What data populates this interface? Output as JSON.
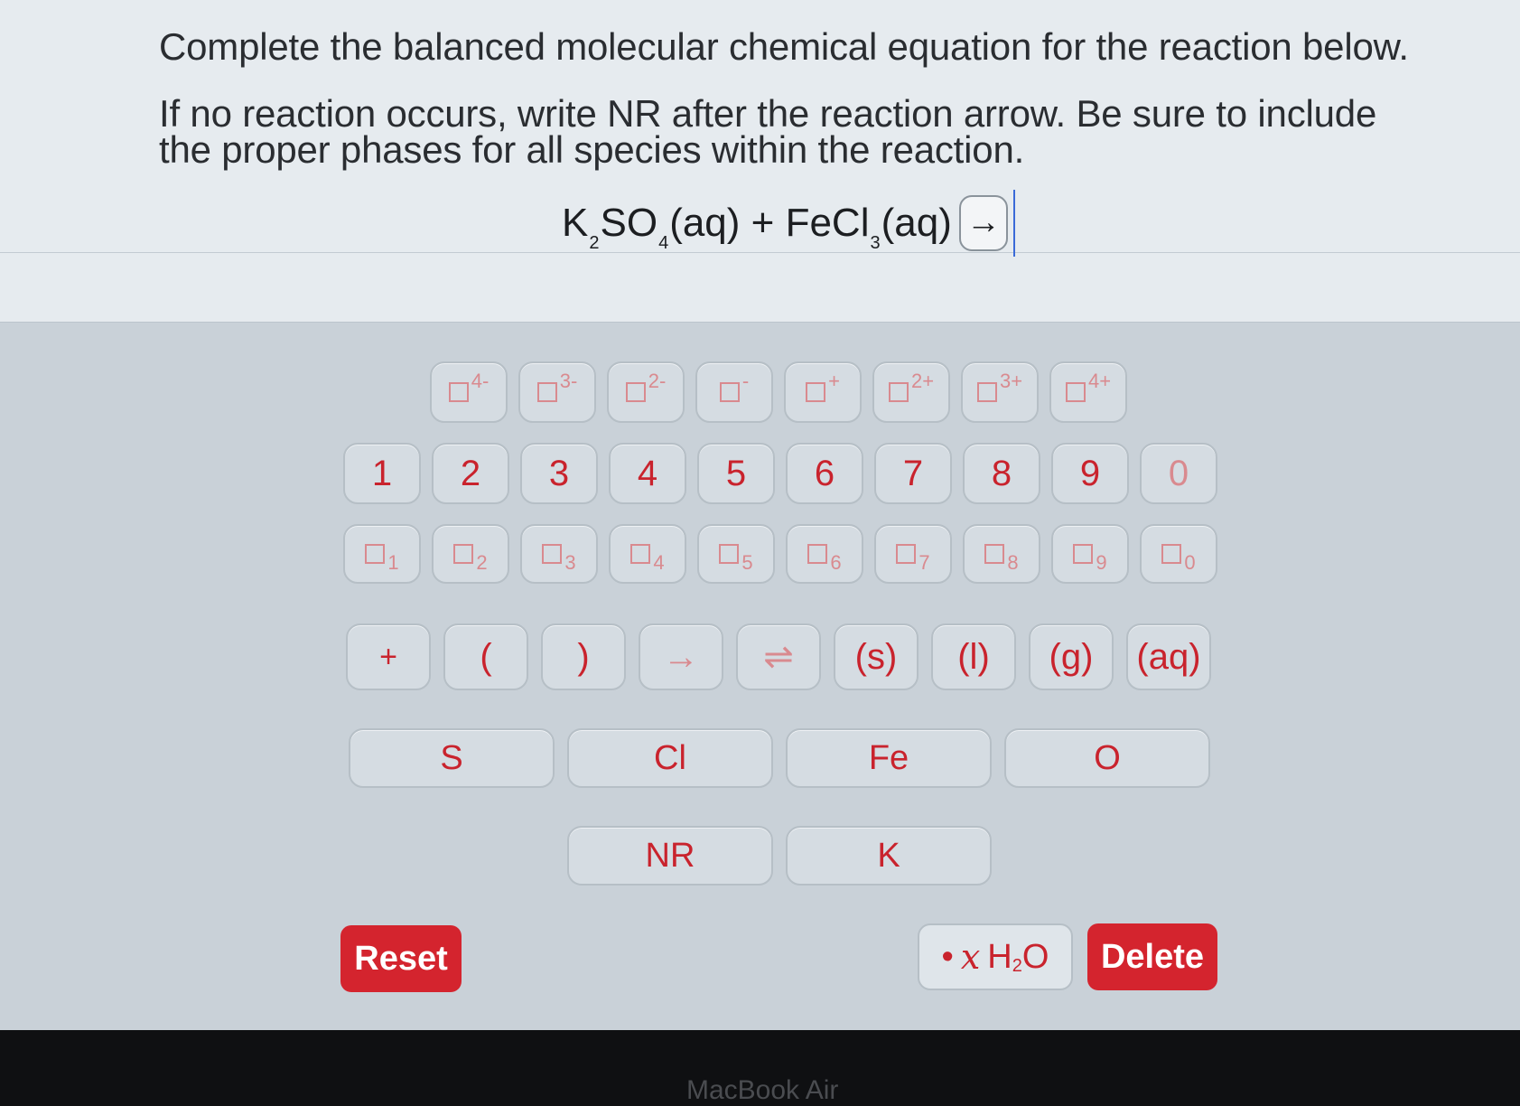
{
  "question": {
    "line1": "Complete the balanced molecular chemical equation for the reaction below.",
    "line2": "If no reaction occurs, write NR after the reaction arrow. Be sure to include",
    "line3": "the proper phases for all species within the reaction."
  },
  "equation": {
    "k": "K",
    "k_sub": "2",
    "so": "SO",
    "so_sub": "4",
    "aq1": "(aq) + FeCl",
    "fecl_sub": "3",
    "aq2": "(aq)",
    "arrow": "→"
  },
  "charges": [
    "4-",
    "3-",
    "2-",
    "-",
    "+",
    "2+",
    "3+",
    "4+"
  ],
  "numbers": [
    "1",
    "2",
    "3",
    "4",
    "5",
    "6",
    "7",
    "8",
    "9",
    "0"
  ],
  "subscripts": [
    "1",
    "2",
    "3",
    "4",
    "5",
    "6",
    "7",
    "8",
    "9",
    "0"
  ],
  "symbols": [
    "+",
    "(",
    ")",
    "→",
    "⇌",
    "(s)",
    "(l)",
    "(g)",
    "(aq)"
  ],
  "elements_row1": [
    "S",
    "Cl",
    "Fe",
    "O"
  ],
  "elements_row2": [
    "NR",
    "K"
  ],
  "buttons": {
    "reset": "Reset",
    "delete": "Delete",
    "hydrate_dot": "•",
    "hydrate_x": "x",
    "hydrate_h": "H",
    "hydrate_sub": "2",
    "hydrate_o": "O"
  },
  "laptop_label": "MacBook Air"
}
